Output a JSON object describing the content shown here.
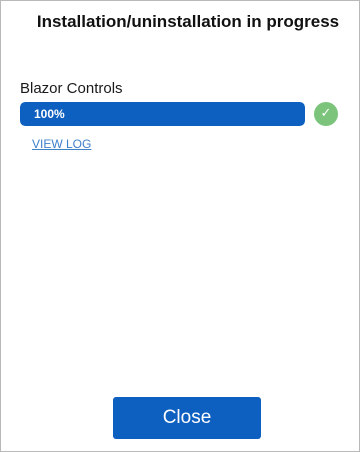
{
  "dialog": {
    "title": "Installation/uninstallation in progress"
  },
  "installs": [
    {
      "product_name": "Blazor Controls",
      "progress": 1.0,
      "progress_label": "100%",
      "status_icon": "checkmark-icon",
      "status_glyph": "✓",
      "view_log_label": "VIEW LOG"
    }
  ],
  "footer": {
    "close_label": "Close"
  },
  "colors": {
    "accent": "#0d5fc0",
    "success": "#7cc47c",
    "link": "#3f80c9"
  }
}
